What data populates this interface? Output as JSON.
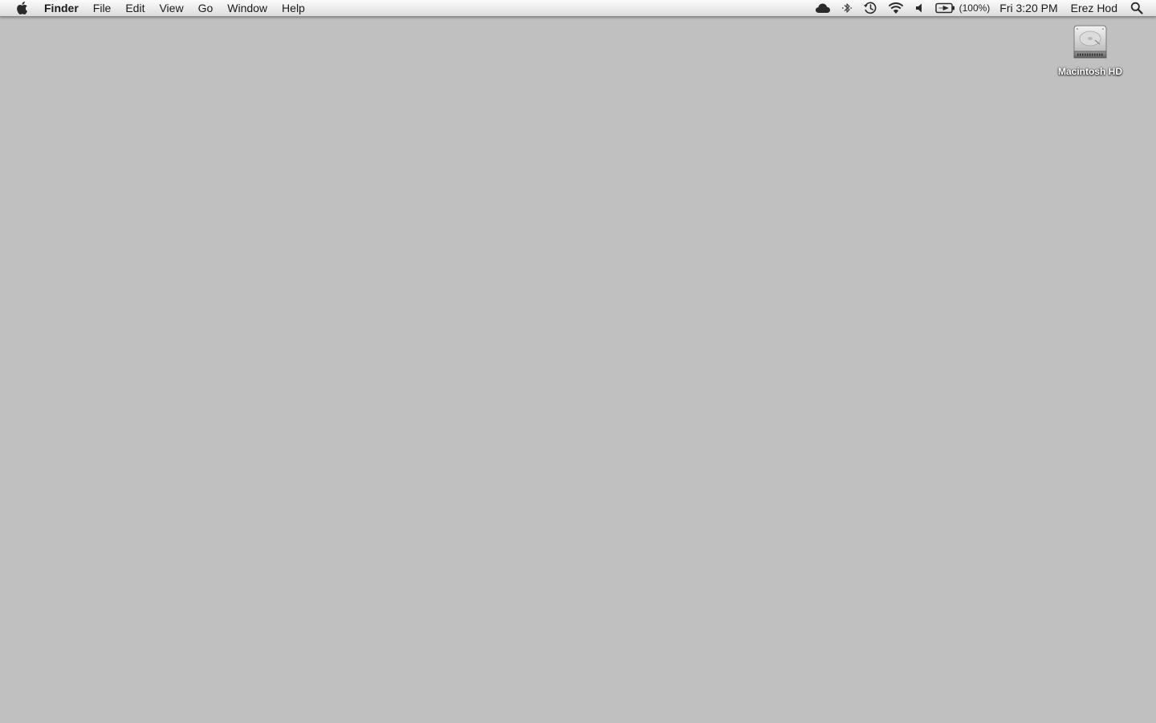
{
  "menubar": {
    "apple_icon": "apple-logo-icon",
    "app_name": "Finder",
    "menus": [
      "File",
      "Edit",
      "View",
      "Go",
      "Window",
      "Help"
    ],
    "status": {
      "icons": [
        "cloud-icon",
        "bluetooth-icon",
        "time-machine-icon",
        "wifi-icon",
        "volume-icon",
        "battery-charging-icon"
      ],
      "battery_percent": "(100%)",
      "clock": "Fri 3:20 PM",
      "user": "Erez Hod",
      "spotlight_icon": "spotlight-search-icon"
    }
  },
  "desktop": {
    "background_color": "#c0c0c0",
    "icons": [
      {
        "label": "Macintosh HD",
        "icon": "hard-drive-icon"
      }
    ]
  }
}
